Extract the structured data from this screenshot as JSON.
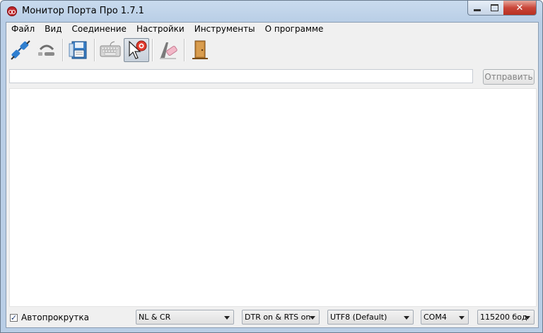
{
  "window": {
    "title": "Монитор Порта Про 1.7.1",
    "controls": {
      "close_glyph": "✕"
    }
  },
  "menu": {
    "items": [
      "Файл",
      "Вид",
      "Соединение",
      "Настройки",
      "Инструменты",
      "О программе"
    ]
  },
  "toolbar": {
    "buttons": [
      {
        "icon": "connect-plug-icon"
      },
      {
        "icon": "disconnect-icon"
      },
      {
        "icon": "save-log-icon"
      },
      {
        "icon": "keyboard-icon"
      },
      {
        "icon": "cursor-help-icon",
        "pressed": true
      },
      {
        "icon": "clear-eraser-icon"
      },
      {
        "icon": "exit-door-icon"
      }
    ]
  },
  "send": {
    "input_value": "",
    "button_label": "Отправить"
  },
  "status": {
    "autoscroll_checked": true,
    "autoscroll_label": "Автопрокрутка",
    "line_ending": "NL & CR",
    "control_lines": "DTR on  & RTS on",
    "encoding": "UTF8 (Default)",
    "port": "COM4",
    "baud": "115200 бод"
  },
  "colors": {
    "window_frame": "#b9cee6",
    "close_button": "#c9463a",
    "panel_bg": "#f0f0f0"
  }
}
